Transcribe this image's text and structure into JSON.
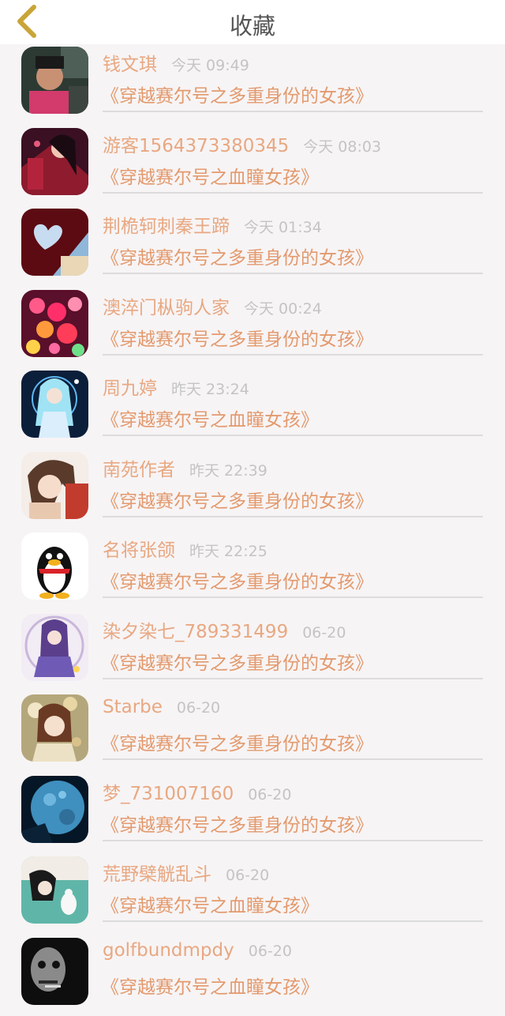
{
  "header": {
    "title": "收藏"
  },
  "colors": {
    "accent": "#e8a882",
    "back_arrow": "#d4b04a",
    "time": "#c4c4c4"
  },
  "items": [
    {
      "name": "钱文琪",
      "time": "今天 09:49",
      "book": "《穿越赛尔号之多重身份的女孩》",
      "avatar": "photo-child"
    },
    {
      "name": "游客1564373380345",
      "time": "今天 08:03",
      "book": "《穿越赛尔号之血瞳女孩》",
      "avatar": "anime-red"
    },
    {
      "name": "荆桅轲刺秦王蹄",
      "time": "今天 01:34",
      "book": "《穿越赛尔号之多重身份的女孩》",
      "avatar": "heart-sky"
    },
    {
      "name": "澳淬门枞驹人家",
      "time": "今天 00:24",
      "book": "《穿越赛尔号之多重身份的女孩》",
      "avatar": "bokeh-lights"
    },
    {
      "name": "周九婷",
      "time": "昨天 23:24",
      "book": "《穿越赛尔号之血瞳女孩》",
      "avatar": "anime-blue"
    },
    {
      "name": "南苑作者",
      "time": "昨天 22:39",
      "book": "《穿越赛尔号之多重身份的女孩》",
      "avatar": "anime-girl"
    },
    {
      "name": "名将张颌",
      "time": "昨天 22:25",
      "book": "《穿越赛尔号之多重身份的女孩》",
      "avatar": "qq-penguin"
    },
    {
      "name": "染夕染七_789331499",
      "time": "06-20",
      "book": "《穿越赛尔号之多重身份的女孩》",
      "avatar": "anime-purple"
    },
    {
      "name": "Starbe",
      "time": "06-20",
      "book": "《穿越赛尔号之多重身份的女孩》",
      "avatar": "anime-flower"
    },
    {
      "name": "梦_731007160",
      "time": "06-20",
      "book": "《穿越赛尔号之多重身份的女孩》",
      "avatar": "blue-moon"
    },
    {
      "name": "荒野檗觥乱斗",
      "time": "06-20",
      "book": "《穿越赛尔号之血瞳女孩》",
      "avatar": "illustration-teal"
    },
    {
      "name": "golfbundmpdy",
      "time": "06-20",
      "book": "《穿越赛尔号之血瞳女孩》",
      "avatar": "photo-bw"
    }
  ]
}
